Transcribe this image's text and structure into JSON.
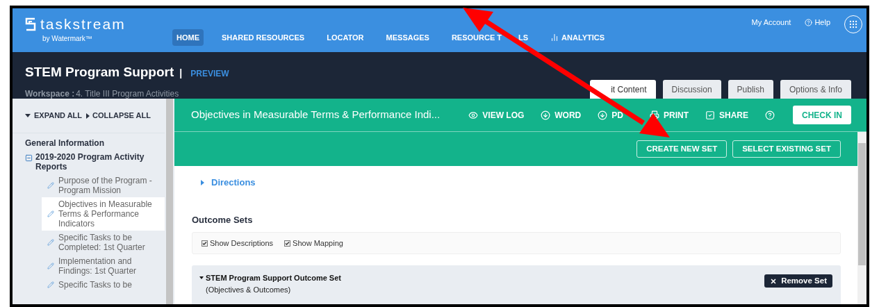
{
  "header": {
    "logo": "taskstream",
    "logo_sub": "by Watermark™",
    "account": "My Account",
    "help": "Help",
    "nav": [
      {
        "label": "HOME",
        "selected": true
      },
      {
        "label": "SHARED RESOURCES",
        "selected": false
      },
      {
        "label": "LOCATOR",
        "selected": false
      },
      {
        "label": "MESSAGES",
        "selected": false
      },
      {
        "label": "RESOURCE T",
        "label_tail": "LS",
        "selected": false
      },
      {
        "label": "ANALYTICS",
        "selected": false,
        "kind": "chart"
      }
    ]
  },
  "workspace": {
    "title": "STEM Program Support",
    "separator": "|",
    "preview": "PREVIEW",
    "label": "Workspace :",
    "value": "4. Title III Program Activities"
  },
  "tabs": [
    {
      "label": "it Content",
      "selected": true
    },
    {
      "label": "Discussion",
      "selected": false
    },
    {
      "label": "Publish",
      "selected": false
    },
    {
      "label": "Options & Info",
      "selected": false
    }
  ],
  "sidebar": {
    "expand_all": "EXPAND ALL",
    "collapse_all": "COLLAPSE ALL",
    "sections": [
      {
        "label": "General Information"
      },
      {
        "label": "2019-2020 Program Activity Reports",
        "expanded": true,
        "children": [
          {
            "label": "Purpose of the Program - Program Mission",
            "selected": false
          },
          {
            "label": "Objectives in Measurable Terms & Performance Indicators",
            "selected": true
          },
          {
            "label": "Specific Tasks to be Completed: 1st Quarter",
            "selected": false
          },
          {
            "label": "Implementation and Findings: 1st Quarter",
            "selected": false
          },
          {
            "label": "Specific Tasks to be",
            "selected": false
          }
        ]
      }
    ]
  },
  "toolbar": {
    "title": "Objectives in Measurable Terms & Performance Indi...",
    "check_in": "CHECK IN",
    "actions": [
      {
        "label": "VIEW LOG",
        "kind": "eye"
      },
      {
        "label": "WORD",
        "kind": "download"
      },
      {
        "label": "PD",
        "kind": "download"
      },
      {
        "label": "PRINT",
        "kind": "print"
      },
      {
        "label": "SHARE",
        "kind": "check"
      },
      {
        "kind": "help"
      }
    ]
  },
  "set_buttons": [
    "CREATE NEW SET",
    "SELECT EXISTING SET"
  ],
  "directions": {
    "label": "Directions",
    "expanded": false
  },
  "outcome_sets": {
    "heading": "Outcome Sets",
    "options": [
      {
        "label": "Show Descriptions",
        "checked": true
      },
      {
        "label": "Show Mapping",
        "checked": true
      }
    ],
    "set": {
      "title": "STEM Program Support Outcome Set",
      "subtitle": "(Objectives & Outcomes)",
      "expanded": true,
      "remove": "Remove Set"
    }
  }
}
